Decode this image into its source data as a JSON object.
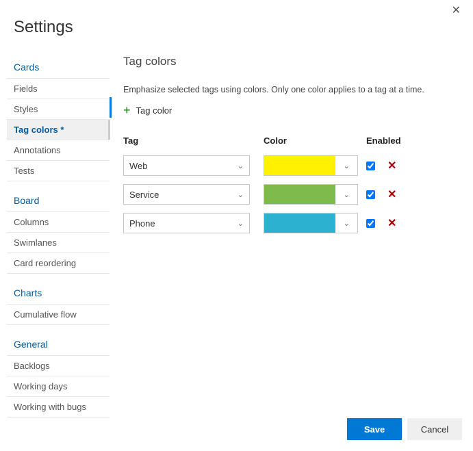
{
  "page_title": "Settings",
  "close_label": "×",
  "sidebar": {
    "sections": [
      {
        "title": "Cards",
        "items": [
          {
            "label": "Fields",
            "active": false
          },
          {
            "label": "Styles",
            "active": false
          },
          {
            "label": "Tag colors *",
            "active": true
          },
          {
            "label": "Annotations",
            "active": false
          },
          {
            "label": "Tests",
            "active": false
          }
        ]
      },
      {
        "title": "Board",
        "items": [
          {
            "label": "Columns",
            "active": false
          },
          {
            "label": "Swimlanes",
            "active": false
          },
          {
            "label": "Card reordering",
            "active": false
          }
        ]
      },
      {
        "title": "Charts",
        "items": [
          {
            "label": "Cumulative flow",
            "active": false
          }
        ]
      },
      {
        "title": "General",
        "items": [
          {
            "label": "Backlogs",
            "active": false
          },
          {
            "label": "Working days",
            "active": false
          },
          {
            "label": "Working with bugs",
            "active": false
          }
        ]
      }
    ]
  },
  "main": {
    "title": "Tag colors",
    "description": "Emphasize selected tags using colors. Only one color applies to a tag at a time.",
    "add_label": "Tag color",
    "columns": {
      "tag": "Tag",
      "color": "Color",
      "enabled": "Enabled"
    },
    "rows": [
      {
        "tag": "Web",
        "color": "#fff100",
        "enabled": true
      },
      {
        "tag": "Service",
        "color": "#7fba4c",
        "enabled": true
      },
      {
        "tag": "Phone",
        "color": "#2cb1d0",
        "enabled": true
      }
    ]
  },
  "footer": {
    "save": "Save",
    "cancel": "Cancel"
  }
}
